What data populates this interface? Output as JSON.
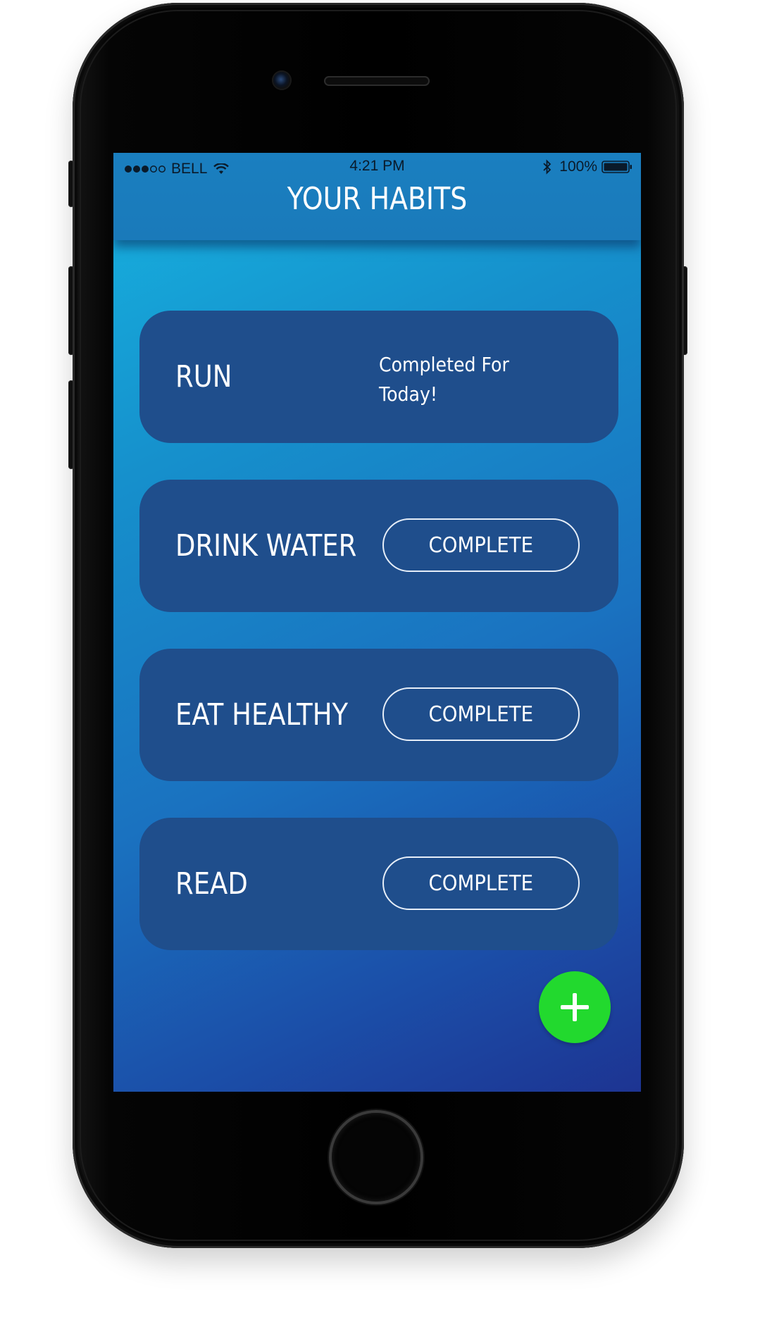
{
  "status_bar": {
    "carrier": "BELL",
    "time": "4:21 PM",
    "battery": "100%",
    "signal_bars_filled": 3,
    "signal_bars_total": 5,
    "wifi_icon": "wifi-icon",
    "bluetooth_icon": "bluetooth-icon",
    "battery_icon": "battery-icon"
  },
  "header": {
    "title": "YOUR HABITS"
  },
  "habits": [
    {
      "name": "RUN",
      "status": "Completed For Today!",
      "completed": true
    },
    {
      "name": "DRINK WATER",
      "button_label": "COMPLETE",
      "completed": false
    },
    {
      "name": "EAT HEALTHY",
      "button_label": "COMPLETE",
      "completed": false
    },
    {
      "name": "READ",
      "button_label": "COMPLETE",
      "completed": false
    }
  ],
  "fab": {
    "icon": "plus-icon",
    "color": "#22d92e"
  },
  "colors": {
    "card": "#1f4e8c",
    "header": "#1a7fc0",
    "gradient_start": "#17b3e0",
    "gradient_end": "#1d3492",
    "text": "#ffffff"
  }
}
